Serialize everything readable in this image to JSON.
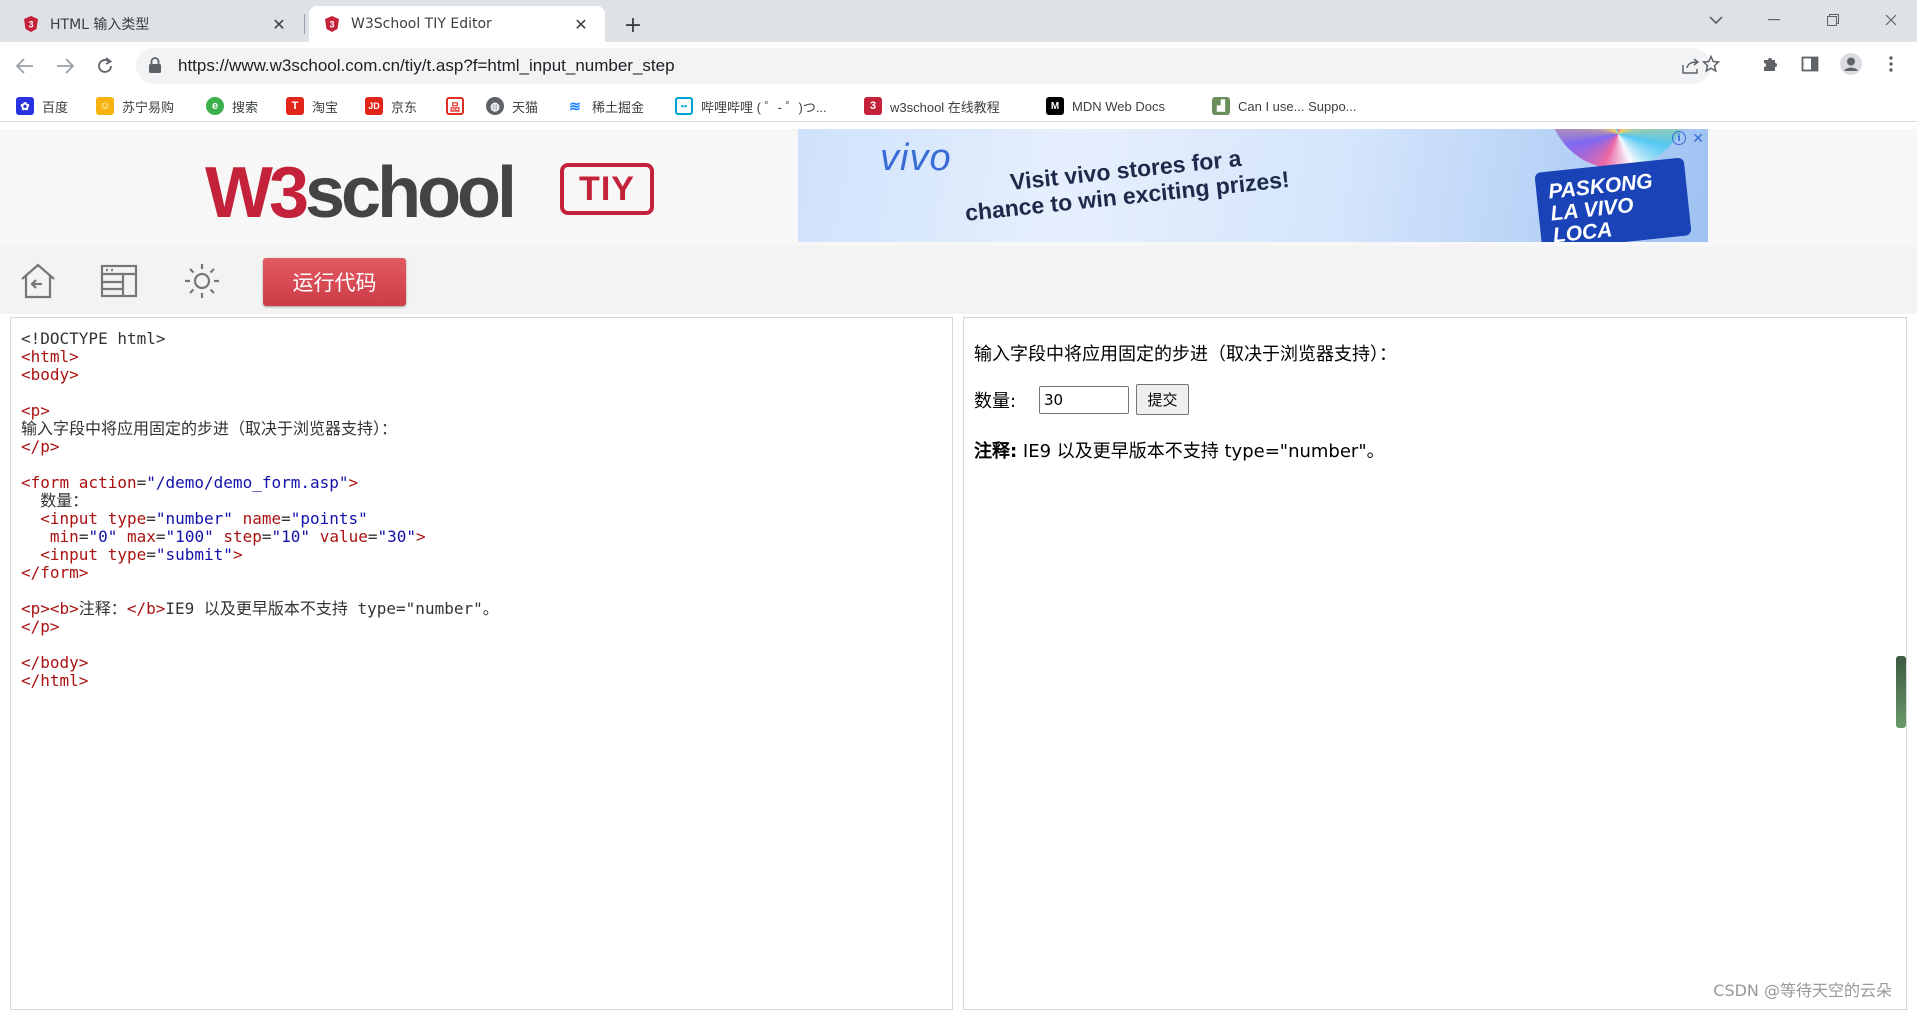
{
  "browser": {
    "tabs": [
      {
        "title": "HTML 输入类型",
        "active": false
      },
      {
        "title": "W3School TIY Editor",
        "active": true
      }
    ],
    "address": "https://www.w3school.com.cn/tiy/t.asp?f=html_input_number_step",
    "bookmarks": [
      {
        "label": "百度",
        "icon": "baidu-icon",
        "color": "#2932e1"
      },
      {
        "label": "苏宁易购",
        "icon": "suning-icon",
        "color": "#f6b20e"
      },
      {
        "label": "搜索",
        "icon": "search-engine-icon",
        "color": "#3cb04a"
      },
      {
        "label": "淘宝",
        "icon": "taobao-icon",
        "color": "#e1251b"
      },
      {
        "label": "京东",
        "icon": "jd-icon",
        "color": "#e1251b"
      },
      {
        "label": "",
        "icon": "pinduoduo-icon",
        "color": "#e02e24"
      },
      {
        "label": "天猫",
        "icon": "globe-icon",
        "color": "#5f6368"
      },
      {
        "label": "稀土掘金",
        "icon": "juejin-icon",
        "color": "#1e80ff"
      },
      {
        "label": "哔哩哔哩 ( ゜- ゜)つ...",
        "icon": "bilibili-icon",
        "color": "#00a1d6"
      },
      {
        "label": "w3school 在线教程",
        "icon": "w3school-icon",
        "color": "#c4223a"
      },
      {
        "label": "MDN Web Docs",
        "icon": "mdn-icon",
        "color": "#000000"
      },
      {
        "label": "Can I use... Suppo...",
        "icon": "caniuse-icon",
        "color": "#6a8f5a"
      }
    ]
  },
  "site": {
    "logo_w3": "W3",
    "logo_school": "school",
    "logo_badge": "TIY",
    "ad": {
      "brand": "vivo",
      "line1": "Visit vivo stores for a",
      "line2": "chance to win exciting prizes!",
      "promo1": "PASKONG",
      "promo2": "LA VIVO LOCA"
    },
    "run_button": "运行代码"
  },
  "code_lines": [
    [
      [
        "t",
        "<!DOCTYPE html>"
      ]
    ],
    [
      [
        "g",
        "<html>"
      ]
    ],
    [
      [
        "g",
        "<body>"
      ]
    ],
    [],
    [
      [
        "g",
        "<p>"
      ]
    ],
    [
      [
        "t",
        "输入字段中将应用固定的步进（取决于浏览器支持）："
      ]
    ],
    [
      [
        "g",
        "</p>"
      ]
    ],
    [],
    [
      [
        "g",
        "<form "
      ],
      [
        "a",
        "action"
      ],
      [
        "t",
        "="
      ],
      [
        "v",
        "\"/demo/demo_form.asp\""
      ],
      [
        "g",
        ">"
      ]
    ],
    [
      [
        "t",
        "  数量："
      ]
    ],
    [
      [
        "g",
        "  <input "
      ],
      [
        "a",
        "type"
      ],
      [
        "t",
        "="
      ],
      [
        "v",
        "\"number\""
      ],
      [
        "t",
        " "
      ],
      [
        "a",
        "name"
      ],
      [
        "t",
        "="
      ],
      [
        "v",
        "\"points\""
      ]
    ],
    [
      [
        "t",
        "   "
      ],
      [
        "a",
        "min"
      ],
      [
        "t",
        "="
      ],
      [
        "v",
        "\"0\""
      ],
      [
        "t",
        " "
      ],
      [
        "a",
        "max"
      ],
      [
        "t",
        "="
      ],
      [
        "v",
        "\"100\""
      ],
      [
        "t",
        " "
      ],
      [
        "a",
        "step"
      ],
      [
        "t",
        "="
      ],
      [
        "v",
        "\"10\""
      ],
      [
        "t",
        " "
      ],
      [
        "a",
        "value"
      ],
      [
        "t",
        "="
      ],
      [
        "v",
        "\"30\""
      ],
      [
        "g",
        ">"
      ]
    ],
    [
      [
        "g",
        "  <input "
      ],
      [
        "a",
        "type"
      ],
      [
        "t",
        "="
      ],
      [
        "v",
        "\"submit\""
      ],
      [
        "g",
        ">"
      ]
    ],
    [
      [
        "g",
        "</form>"
      ]
    ],
    [],
    [
      [
        "g",
        "<p><b>"
      ],
      [
        "t",
        "注释："
      ],
      [
        "g",
        "</b>"
      ],
      [
        "t",
        "IE9 以及更早版本不支持 type=\"number\"。"
      ]
    ],
    [
      [
        "g",
        "</p>"
      ]
    ],
    [],
    [
      [
        "g",
        "</body>"
      ]
    ],
    [
      [
        "g",
        "</html>"
      ]
    ]
  ],
  "result": {
    "intro": "输入字段中将应用固定的步进（取决于浏览器支持）：",
    "quantity_label": "数量:",
    "quantity_value": "30",
    "submit_label": "提交",
    "note_bold": "注释:",
    "note_text": " IE9 以及更早版本不支持 type=\"number\"。"
  },
  "watermark": "CSDN @等待天空的云朵"
}
